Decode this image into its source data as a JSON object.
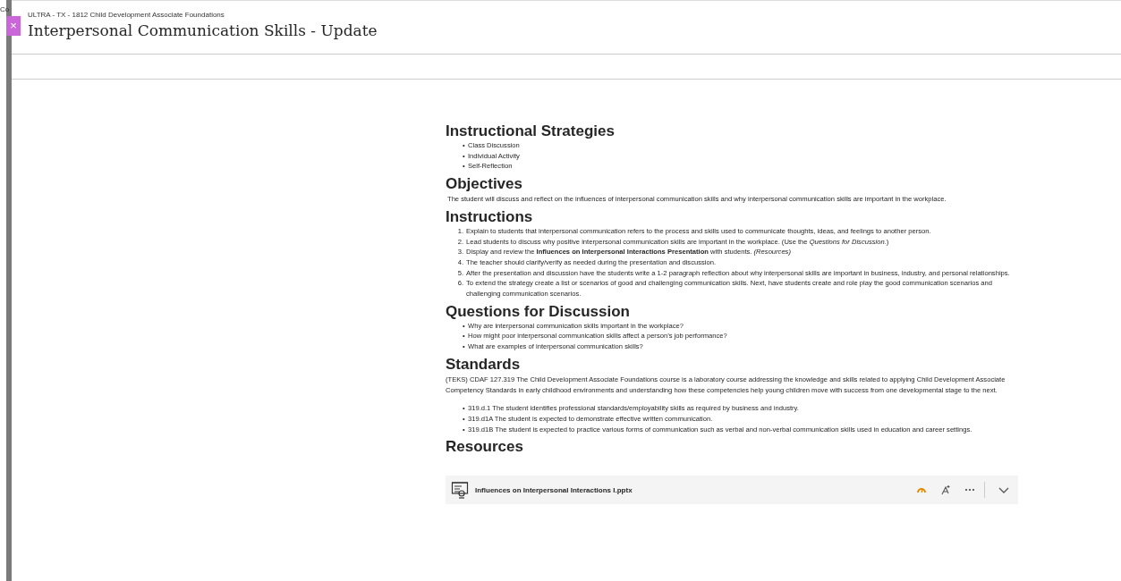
{
  "side_strip": {
    "label": "Co"
  },
  "header": {
    "course": "ULTRA - TX - 1812 Child Development Associate Foundations",
    "title": "Interpersonal Communication Skills - Update",
    "close": "×"
  },
  "sections": [
    {
      "heading": "Instructional Strategies",
      "kind": "bullets",
      "marker": "•",
      "items": [
        "Class Discussion",
        "Individual Activity",
        "Self-Reflection"
      ]
    },
    {
      "heading": "Objectives",
      "kind": "paragraph",
      "text": "The student will discuss and reflect on the influences of interpersonal communication skills and why interpersonal communication skills are important in the workplace."
    },
    {
      "heading": "Instructions",
      "kind": "numbered",
      "items": [
        {
          "number": "1.",
          "text": "Explain to students that interpersonal communication refers to the process and skills used to communicate thoughts, ideas, and feelings to another person."
        },
        {
          "number": "2.",
          "text": "Lead students to discuss why positive interpersonal communication skills are important in the workplace. (Use the *Questions for Discussion*.)"
        },
        {
          "number": "3.",
          "text": "Display and review the **Influences on Interpersonal Interactions Presentation** with students. *(Resources)*"
        },
        {
          "number": "4.",
          "text": "The teacher should clarify/verify as needed during the presentation and discussion."
        },
        {
          "number": "5.",
          "text": "After the presentation and discussion have the students write a 1-2 paragraph reflection about why interpersonal skills are important in business, industry, and personal relationships."
        },
        {
          "number": "6.",
          "text": "To extend the strategy create a list or scenarios of good and challenging communication skills. Next, have students create and role play the good communication scenarios and challenging communication scenarios."
        }
      ]
    },
    {
      "heading": "Questions for Discussion",
      "kind": "bullets",
      "marker": "•",
      "items": [
        "Why are interpersonal communication skills important in the workplace?",
        "How might poor interpersonal communication skills affect a person’s job performance?",
        "What are examples of interpersonal communication skills?"
      ]
    },
    {
      "heading": "Standards",
      "kind": "paragraph_bullets",
      "text": "(TEKS) CDAF 127.319 The Child Development Associate Foundations course is a laboratory course addressing the knowledge and skills related to applying Child Development Associate Competency Standards in early childhood environments and understanding how these competencies help young children move with success from one developmental stage to the next.",
      "marker": "•",
      "items": [
        "319.d.1 The student identifies professional standards/employability skills as required by business and industry.",
        "319.d1A The student is expected to demonstrate effective written communication.",
        "319.d1B The student is expected to practice various forms of communication such as verbal and non-verbal communication skills used in education and career settings."
      ]
    },
    {
      "heading": "Resources",
      "kind": "files",
      "files": [
        {
          "name": "Influences on Interpersonal Interactions I.pptx"
        }
      ]
    }
  ]
}
